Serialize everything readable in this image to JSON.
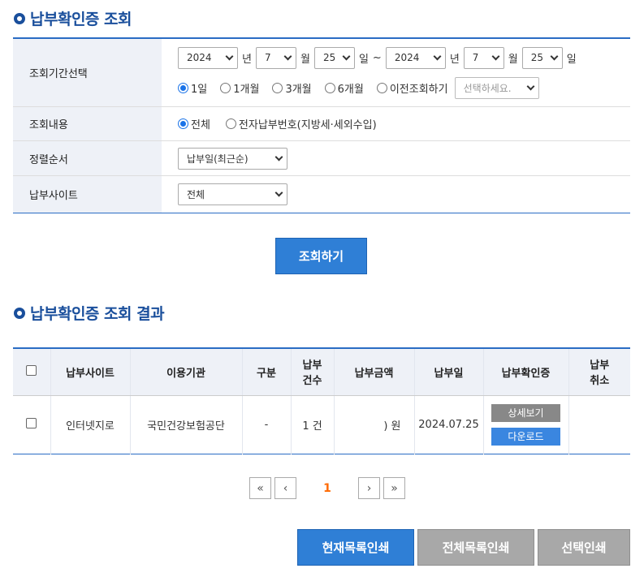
{
  "search_section": {
    "title": "납부확인증 조회",
    "period_label": "조회기간선택",
    "from": {
      "year": "2024",
      "year_unit": "년",
      "month": "7",
      "month_unit": "월",
      "day": "25",
      "day_unit": "일"
    },
    "range_sep": "~",
    "to": {
      "year": "2024",
      "year_unit": "년",
      "month": "7",
      "month_unit": "월",
      "day": "25",
      "day_unit": "일"
    },
    "period_options": [
      {
        "label": "1일",
        "selected": true
      },
      {
        "label": "1개월",
        "selected": false
      },
      {
        "label": "3개월",
        "selected": false
      },
      {
        "label": "6개월",
        "selected": false
      },
      {
        "label": "이전조회하기",
        "selected": false
      }
    ],
    "previous_select_placeholder": "선택하세요.",
    "content_label": "조회내용",
    "content_options": [
      {
        "label": "전체",
        "selected": true
      },
      {
        "label": "전자납부번호(지방세·세외수입)",
        "selected": false
      }
    ],
    "sort_label": "정렬순서",
    "sort_value": "납부일(최근순)",
    "site_label": "납부사이트",
    "site_value": "전체",
    "search_button": "조회하기"
  },
  "result_section": {
    "title": "납부확인증 조회 결과",
    "headers": {
      "site": "납부사이트",
      "org": "이용기관",
      "type": "구분",
      "count_line1": "납부",
      "count_line2": "건수",
      "amount": "납부금액",
      "date": "납부일",
      "cert": "납부확인증",
      "cancel_line1": "납부",
      "cancel_line2": "취소"
    },
    "rows": [
      {
        "site": "인터넷지로",
        "org": "국민건강보험공단",
        "type": "-",
        "count": "1 건",
        "amount": ") 원",
        "date": "2024.07.25",
        "detail_button": "상세보기",
        "download_button": "다운로드",
        "cancel": ""
      }
    ]
  },
  "pagination": {
    "first": "«",
    "prev": "‹",
    "current": "1",
    "next": "›",
    "last": "»"
  },
  "footer_buttons": {
    "print_current": "현재목록인쇄",
    "print_all": "전체목록인쇄",
    "print_selected": "선택인쇄"
  }
}
